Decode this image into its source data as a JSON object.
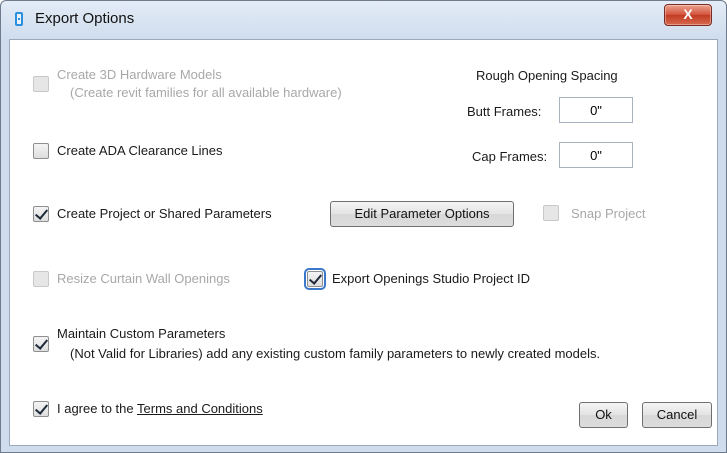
{
  "window": {
    "title": "Export Options",
    "close_label": "X"
  },
  "options": {
    "create_3d": {
      "label": "Create 3D Hardware Models",
      "sublabel": "(Create revit families for all available hardware)",
      "checked": false,
      "enabled": false
    },
    "ada": {
      "label": "Create ADA Clearance Lines",
      "checked": false,
      "enabled": true
    },
    "project_params": {
      "label": "Create Project or Shared Parameters",
      "checked": true,
      "enabled": true
    },
    "edit_params_button": "Edit Parameter Options",
    "snap_project": {
      "label": "Snap Project",
      "checked": false,
      "enabled": false
    },
    "resize_curtain": {
      "label": "Resize Curtain Wall Openings",
      "checked": false,
      "enabled": false
    },
    "export_id": {
      "label": "Export Openings Studio Project ID",
      "checked": true,
      "enabled": true
    },
    "maintain_custom": {
      "label": "Maintain Custom Parameters",
      "sublabel": "(Not Valid for Libraries) add any existing custom family parameters to newly created models.",
      "checked": true,
      "enabled": true
    },
    "agree": {
      "label": "I agree to the",
      "link": "Terms and Conditions",
      "checked": true,
      "enabled": true
    }
  },
  "spacing": {
    "heading": "Rough Opening Spacing",
    "butt_label": "Butt Frames:",
    "butt_value": "0\"",
    "cap_label": "Cap Frames:",
    "cap_value": "0\""
  },
  "buttons": {
    "ok": "Ok",
    "cancel": "Cancel"
  }
}
